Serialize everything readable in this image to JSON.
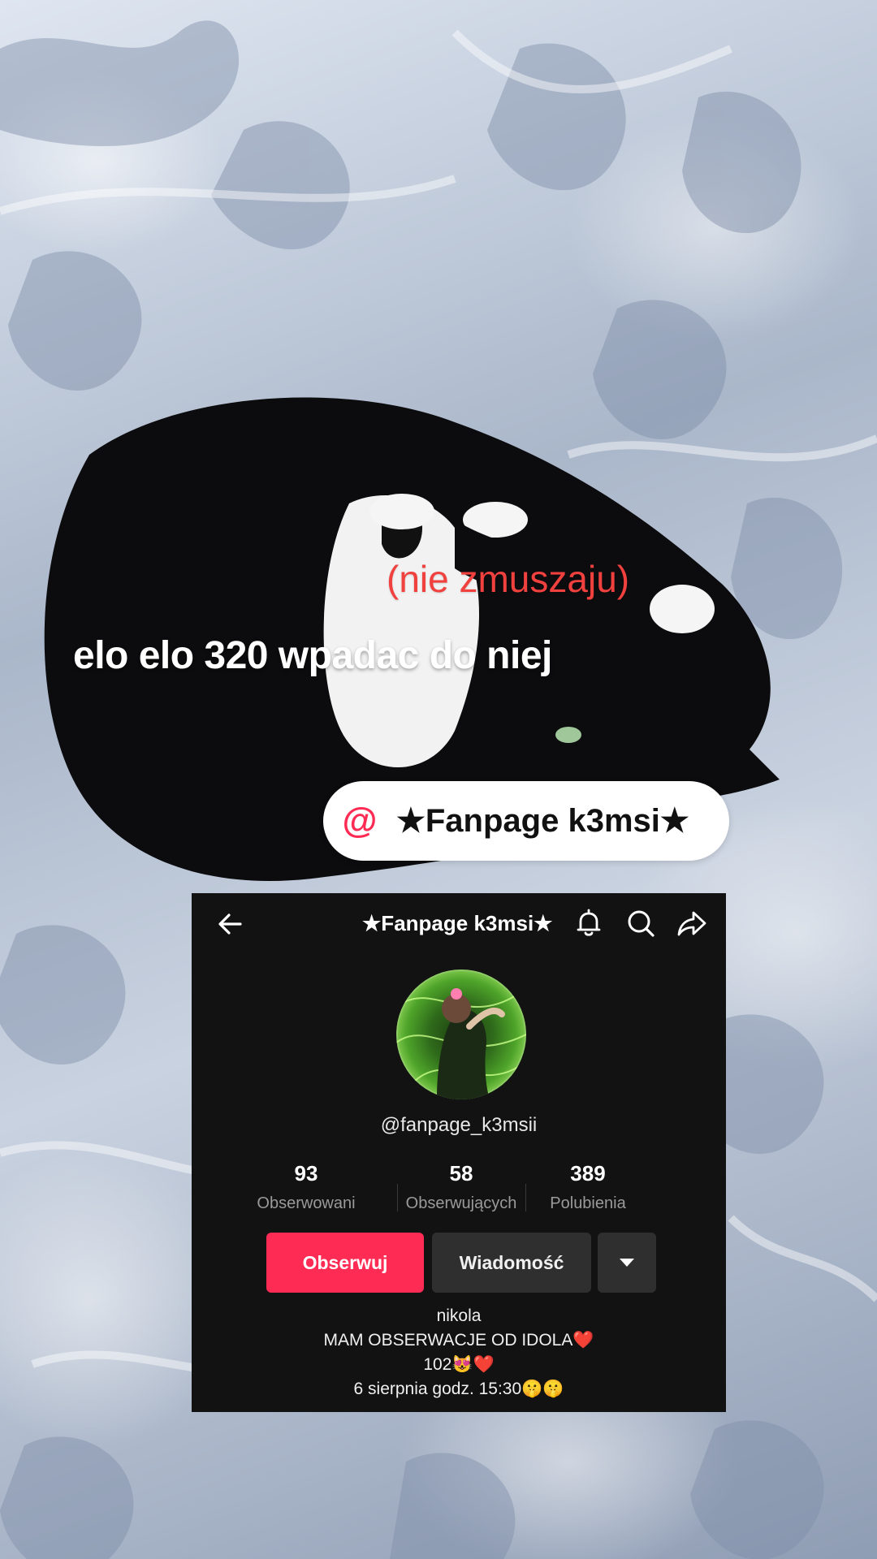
{
  "overlay": {
    "subtitle_red": "(nie zmuszaju)",
    "caption": "elo elo 320 wpadac do niej",
    "mention_symbol": "@",
    "mention_name": "★Fanpage k3msi★"
  },
  "profile": {
    "title": "★Fanpage k3msi★",
    "handle": "@fanpage_k3msii",
    "stats": [
      {
        "value": "93",
        "label": "Obserwowani"
      },
      {
        "value": "58",
        "label": "Obserwujących"
      },
      {
        "value": "389",
        "label": "Polubienia"
      }
    ],
    "follow_label": "Obserwuj",
    "message_label": "Wiadomość",
    "bio": [
      "nikola",
      "MAM OBSERWACJE OD IDOLA❤️",
      "102😻❤️",
      "6 sierpnia godz. 15:30🤫🤫"
    ],
    "icons": [
      "back-arrow-icon",
      "bell-icon",
      "search-icon",
      "share-icon",
      "dropdown-caret-icon"
    ]
  },
  "colors": {
    "accent": "#fe2c55",
    "red_text": "#f0413f",
    "panel_bg": "#121212",
    "button_dark": "#2f2f2f"
  }
}
